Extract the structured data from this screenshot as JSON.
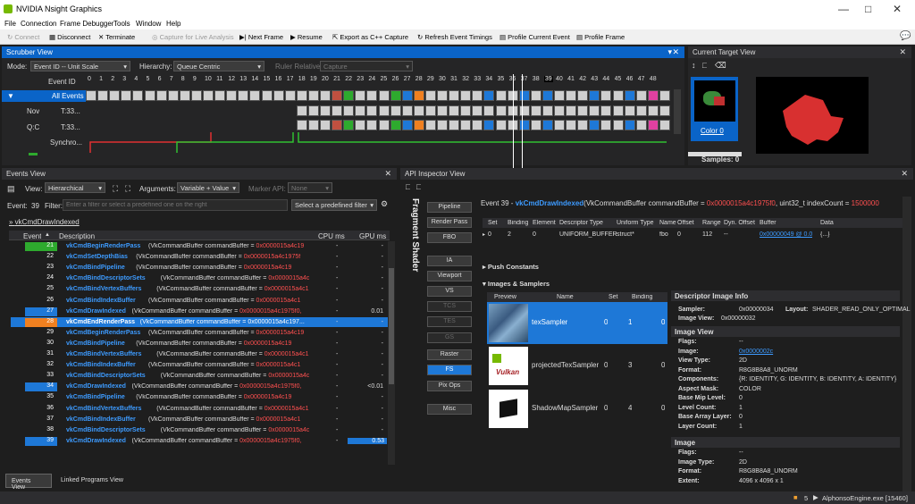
{
  "app": {
    "title": "NVIDIA Nsight Graphics"
  },
  "menu": [
    "File",
    "Connection",
    "Frame Debugger",
    "Tools",
    "Window",
    "Help"
  ],
  "toolbar": {
    "connect": "Connect",
    "disconnect": "Disconnect",
    "terminate": "Terminate",
    "capture_live": "Capture for Live Analysis",
    "next_frame": "Next Frame",
    "resume": "Resume",
    "export_cpp": "Export as C++ Capture",
    "refresh": "Refresh Event Timings",
    "profile_event": "Profile Current Event",
    "profile_frame": "Profile Frame"
  },
  "scrubber": {
    "title": "Scrubber View",
    "mode_label": "Mode:",
    "mode_value": "Event ID -- Unit Scale",
    "hier_label": "Hierarchy:",
    "hier_value": "Queue Centric",
    "ruler_label": "Ruler Relative:",
    "ruler_value": "Capture",
    "event_id_label": "Event ID",
    "rows": [
      "All Events",
      "T:33...",
      "T:33...",
      "Synchro..."
    ],
    "row_prefix": [
      "",
      "Nov",
      "Q:C",
      ""
    ],
    "ticks": [
      "0",
      "1",
      "2",
      "3",
      "4",
      "5",
      "6",
      "7",
      "8",
      "9",
      "10",
      "11",
      "12",
      "13",
      "14",
      "15",
      "16",
      "17",
      "18",
      "19",
      "20",
      "21",
      "22",
      "23",
      "24",
      "25",
      "26",
      "27",
      "28",
      "29",
      "30",
      "31",
      "32",
      "33",
      "34",
      "35",
      "36",
      "37",
      "38",
      "39",
      "40",
      "41",
      "42",
      "43",
      "44",
      "45",
      "46",
      "47",
      "48"
    ]
  },
  "target": {
    "title": "Current Target View",
    "thumb_label": "Color 0",
    "samples": "Samples: 0"
  },
  "events": {
    "title": "Events View",
    "view_label": "View:",
    "view_value": "Hierarchical",
    "args_label": "Arguments:",
    "args_value": "Variable + Value",
    "marker_label": "Marker API:",
    "marker_value": "None",
    "event_label": "Event:",
    "event_num": "39",
    "filter_label": "Filter:",
    "filter_placeholder": "Enter a filter or select a predefined one on the right",
    "predef": "Select a predefined filter",
    "breadcrumb": "vkCmdDrawIndexed",
    "col_event": "Event",
    "col_desc": "Description",
    "col_cpu": "CPU ms",
    "col_gpu": "GPU ms",
    "rows": [
      {
        "n": "21",
        "fn": "vkCmdBeginRenderPass",
        "args": "(VkCommandBuffer commandBuffer = ",
        "addr": "0x0000015a4c19",
        "cpu": "-",
        "gpu": "-"
      },
      {
        "n": "22",
        "fn": "vkCmdSetDepthBias",
        "args": "(VkCommandBuffer commandBuffer = ",
        "addr": "0x0000015a4c1975f",
        "cpu": "-",
        "gpu": "-"
      },
      {
        "n": "23",
        "fn": "vkCmdBindPipeline",
        "args": "(VkCommandBuffer commandBuffer = ",
        "addr": "0x0000015a4c19",
        "cpu": "-",
        "gpu": "-"
      },
      {
        "n": "24",
        "fn": "vkCmdBindDescriptorSets",
        "args": "(VkCommandBuffer commandBuffer = ",
        "addr": "0x0000015a4c",
        "cpu": "-",
        "gpu": "-"
      },
      {
        "n": "25",
        "fn": "vkCmdBindVertexBuffers",
        "args": "(VkCommandBuffer commandBuffer = ",
        "addr": "0x0000015a4c1",
        "cpu": "-",
        "gpu": "-"
      },
      {
        "n": "26",
        "fn": "vkCmdBindIndexBuffer",
        "args": "(VkCommandBuffer commandBuffer = ",
        "addr": "0x0000015a4c1",
        "cpu": "-",
        "gpu": "-"
      },
      {
        "n": "27",
        "fn": "vkCmdDrawIndexed",
        "args": "(VkCommandBuffer commandBuffer = ",
        "addr": "0x0000015a4c1975f0,",
        "cpu": "-",
        "gpu": "0.01"
      },
      {
        "n": "28",
        "fn": "vkCmdEndRenderPass",
        "args": "(VkCommandBuffer commandBuffer = 0x0000015a4c197...",
        "addr": "",
        "cpu": "-",
        "gpu": "-"
      },
      {
        "n": "29",
        "fn": "vkCmdBeginRenderPass",
        "args": "(VkCommandBuffer commandBuffer = ",
        "addr": "0x0000015a4c19",
        "cpu": "-",
        "gpu": "-"
      },
      {
        "n": "30",
        "fn": "vkCmdBindPipeline",
        "args": "(VkCommandBuffer commandBuffer = ",
        "addr": "0x0000015a4c19",
        "cpu": "-",
        "gpu": "-"
      },
      {
        "n": "31",
        "fn": "vkCmdBindVertexBuffers",
        "args": "(VkCommandBuffer commandBuffer = ",
        "addr": "0x0000015a4c1",
        "cpu": "-",
        "gpu": "-"
      },
      {
        "n": "32",
        "fn": "vkCmdBindIndexBuffer",
        "args": "(VkCommandBuffer commandBuffer = ",
        "addr": "0x0000015a4c1",
        "cpu": "-",
        "gpu": "-"
      },
      {
        "n": "33",
        "fn": "vkCmdBindDescriptorSets",
        "args": "(VkCommandBuffer commandBuffer = ",
        "addr": "0x0000015a4c",
        "cpu": "-",
        "gpu": "-"
      },
      {
        "n": "34",
        "fn": "vkCmdDrawIndexed",
        "args": "(VkCommandBuffer commandBuffer = ",
        "addr": "0x0000015a4c1975f0,",
        "cpu": "-",
        "gpu": "<0.01"
      },
      {
        "n": "35",
        "fn": "vkCmdBindPipeline",
        "args": "(VkCommandBuffer commandBuffer = ",
        "addr": "0x0000015a4c19",
        "cpu": "-",
        "gpu": "-"
      },
      {
        "n": "36",
        "fn": "vkCmdBindVertexBuffers",
        "args": "(VkCommandBuffer commandBuffer = ",
        "addr": "0x0000015a4c1",
        "cpu": "-",
        "gpu": "-"
      },
      {
        "n": "37",
        "fn": "vkCmdBindIndexBuffer",
        "args": "(VkCommandBuffer commandBuffer = ",
        "addr": "0x0000015a4c1",
        "cpu": "-",
        "gpu": "-"
      },
      {
        "n": "38",
        "fn": "vkCmdBindDescriptorSets",
        "args": "(VkCommandBuffer commandBuffer = ",
        "addr": "0x0000015a4c",
        "cpu": "-",
        "gpu": "-"
      },
      {
        "n": "39",
        "fn": "vkCmdDrawIndexed",
        "args": "(VkCommandBuffer commandBuffer = ",
        "addr": "0x0000015a4c1975f0,",
        "cpu": "-",
        "gpu": "0.53"
      }
    ],
    "tab_events": "Events View",
    "tab_linked": "Linked Programs View"
  },
  "inspector": {
    "title": "API Inspector View",
    "stage_label": "Fragment Shader",
    "stages": [
      "Pipeline",
      "Render Pass",
      "FBO",
      "IA",
      "Viewport",
      "VS",
      "TCS",
      "TES",
      "GS",
      "Raster",
      "FS",
      "Pix Ops",
      "Misc"
    ],
    "header_event": "Event 39 - ",
    "header_fn": "vkCmdDrawIndexed",
    "header_args": "(VkCommandBuffer commandBuffer = ",
    "header_addr": "0x0000015a4c1975f0",
    "header_args2": ", uint32_t indexCount = ",
    "header_count": "1500000",
    "desc_cols": [
      "Set",
      "Binding",
      "Element",
      "Descriptor Type",
      "Uniform Type",
      "Name",
      "Offset",
      "Range",
      "Dyn. Offset",
      "Buffer",
      "Data"
    ],
    "desc_row": [
      "0",
      "2",
      "0",
      "UNIFORM_BUFFER",
      "struct*",
      "fbo",
      "0",
      "112",
      "--",
      "0x00000049 @ 0.0",
      "{...}"
    ],
    "push_constants": "Push Constants",
    "images_samplers": "Images & Samplers",
    "img_cols": [
      "Preview",
      "Name",
      "Set",
      "Binding"
    ],
    "img_rows": [
      {
        "name": "texSampler",
        "set": "0",
        "binding": "1",
        "x": "0"
      },
      {
        "name": "projectedTexSampler",
        "set": "0",
        "binding": "3",
        "x": "0"
      },
      {
        "name": "ShadowMapSampler",
        "set": "0",
        "binding": "4",
        "x": "0"
      }
    ],
    "vulkan_logo": "Vulkan",
    "dii": {
      "title": "Descriptor Image Info",
      "sampler_k": "Sampler:",
      "sampler_v": "0x00000034",
      "layout_k": "Layout:",
      "layout_v": "SHADER_READ_ONLY_OPTIMAL",
      "view_k": "Image View:",
      "view_v": "0x00000032"
    },
    "iv": {
      "title": "Image View",
      "rows": [
        [
          "Flags:",
          "--"
        ],
        [
          "Image:",
          "0x0000002c"
        ],
        [
          "View Type:",
          "2D"
        ],
        [
          "Format:",
          "R8G8B8A8_UNORM"
        ],
        [
          "Components:",
          "{R: IDENTITY, G: IDENTITY, B: IDENTITY, A: IDENTITY}"
        ],
        [
          "Aspect Mask:",
          "COLOR"
        ],
        [
          "Base Mip Level:",
          "0"
        ],
        [
          "Level Count:",
          "1"
        ],
        [
          "Base Array Layer:",
          "0"
        ],
        [
          "Layer Count:",
          "1"
        ]
      ]
    },
    "img": {
      "title": "Image",
      "rows": [
        [
          "Flags:",
          "--"
        ],
        [
          "Image Type:",
          "2D"
        ],
        [
          "Format:",
          "R8G8B8A8_UNORM"
        ],
        [
          "Extent:",
          "4096 x 4096 x 1"
        ]
      ]
    }
  },
  "status": {
    "count": "5",
    "process": "AlphonsoEngine.exe [15460]"
  }
}
